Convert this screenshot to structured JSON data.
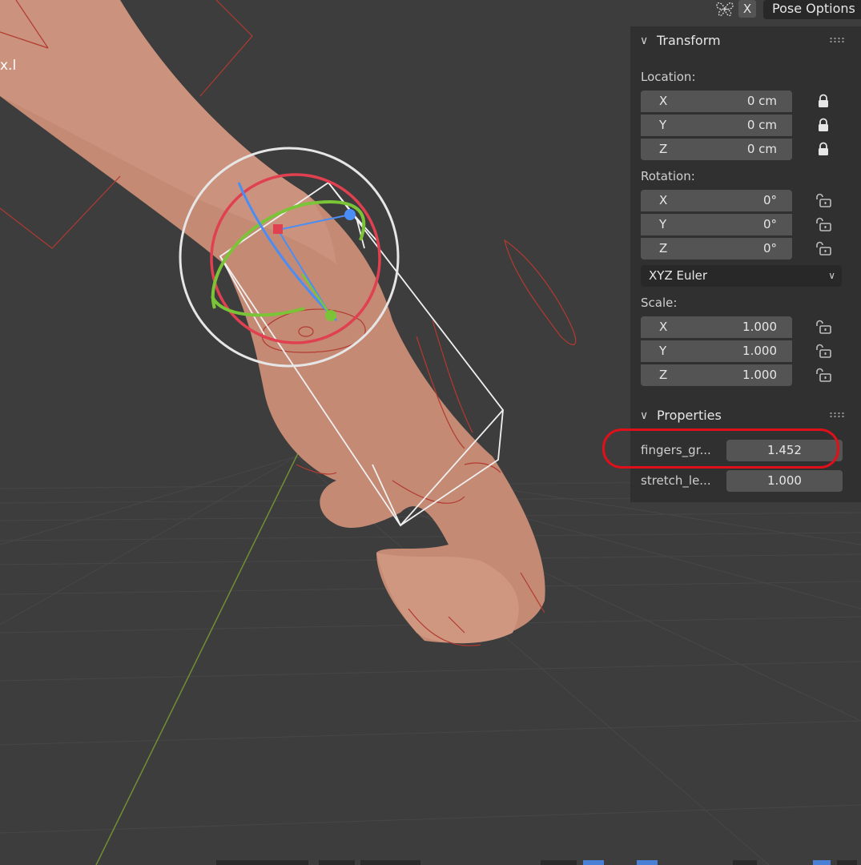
{
  "viewport": {
    "bone_label": "x.l",
    "colors": {
      "background": "#3d3d3d",
      "grid_line": "#4a4a4a",
      "y_axis": "#7a9a3a",
      "skin": "#c8907a",
      "bone_wire": "#c0392b",
      "gizmo_red": "#e0404f",
      "gizmo_green": "#7cc437",
      "gizmo_blue": "#4a8ef5",
      "gizmo_white": "#e8e8e8"
    }
  },
  "header": {
    "symmetry_icon": "butterfly-symmetry-icon",
    "axis_toggle": "X",
    "pose_options": "Pose Options"
  },
  "panel": {
    "transform": {
      "title": "Transform",
      "location_label": "Location:",
      "location": [
        {
          "axis": "X",
          "value": "0 cm"
        },
        {
          "axis": "Y",
          "value": "0 cm"
        },
        {
          "axis": "Z",
          "value": "0 cm"
        }
      ],
      "rotation_label": "Rotation:",
      "rotation": [
        {
          "axis": "X",
          "value": "0°"
        },
        {
          "axis": "Y",
          "value": "0°"
        },
        {
          "axis": "Z",
          "value": "0°"
        }
      ],
      "rotation_mode": "XYZ Euler",
      "scale_label": "Scale:",
      "scale": [
        {
          "axis": "X",
          "value": "1.000"
        },
        {
          "axis": "Y",
          "value": "1.000"
        },
        {
          "axis": "Z",
          "value": "1.000"
        }
      ]
    },
    "properties": {
      "title": "Properties",
      "items": [
        {
          "label": "fingers_gr...",
          "value": "1.452"
        },
        {
          "label": "stretch_le...",
          "value": "1.000"
        }
      ]
    }
  }
}
